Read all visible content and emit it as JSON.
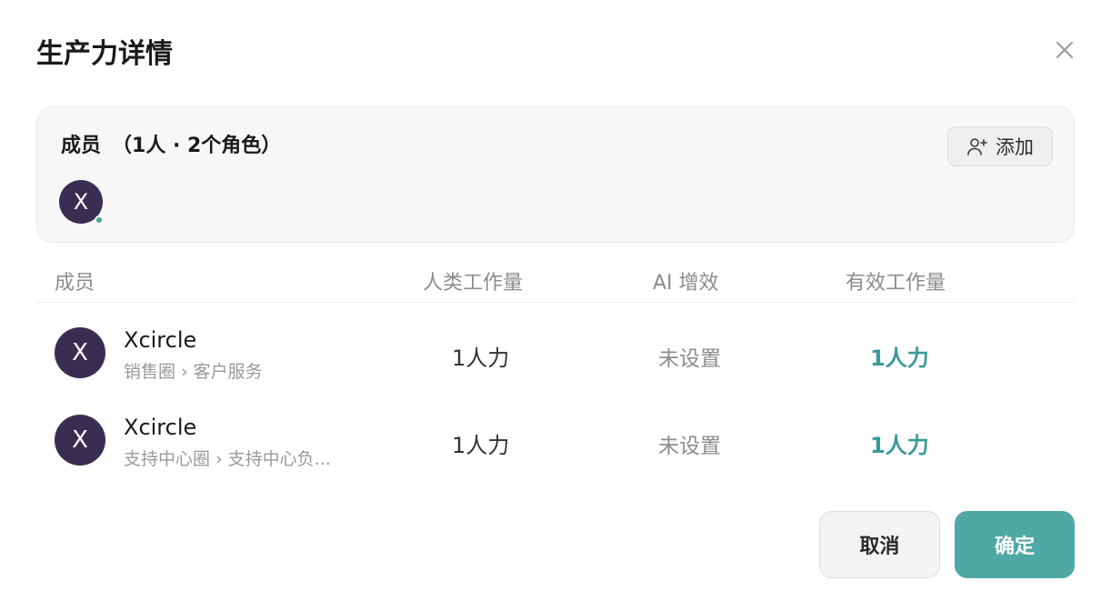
{
  "dialog": {
    "title": "生产力详情"
  },
  "members_panel": {
    "heading": "成员",
    "count_text": "（1人 · 2个角色）",
    "add_label": "添加",
    "avatar_initial": "X"
  },
  "table": {
    "headers": [
      "成员",
      "人类工作量",
      "AI 增效",
      "有效工作量"
    ],
    "rows": [
      {
        "initial": "X",
        "name": "Xcircle",
        "path": "销售圈 › 客户服务",
        "human_workload": "1人力",
        "ai_boost": "未设置",
        "effective_workload": "1人力"
      },
      {
        "initial": "X",
        "name": "Xcircle",
        "path": "支持中心圈 › 支持中心负...",
        "human_workload": "1人力",
        "ai_boost": "未设置",
        "effective_workload": "1人力"
      }
    ]
  },
  "footer": {
    "cancel_label": "取消",
    "ok_label": "确定"
  },
  "colors": {
    "accent": "#4fa8a6",
    "avatar": "#3a2d52",
    "online": "#3fae7a"
  },
  "icons": {
    "close": "close-icon",
    "add_user": "add-user-icon"
  }
}
